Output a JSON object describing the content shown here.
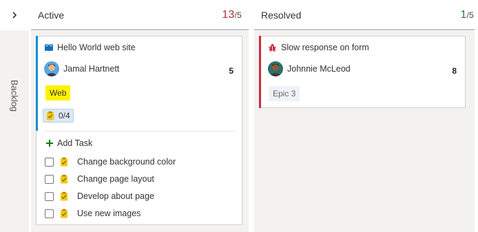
{
  "backlog": {
    "label": "Backlog",
    "toggle_icon": "chevron-right-icon"
  },
  "columns": [
    {
      "title": "Active",
      "count": "13",
      "limit": "/5",
      "count_color": "#b03030",
      "cards": [
        {
          "type_icon": "book-icon",
          "title": "Hello World web site",
          "assignee": "Jamal Hartnett",
          "effort": "5",
          "tag": "Web",
          "tag_color": "#fff200",
          "bar_color": "#0e8fd0",
          "progress": "0/4",
          "add_task_label": "Add Task",
          "tasks": [
            {
              "label": "Change background color"
            },
            {
              "label": "Change page layout"
            },
            {
              "label": "Develop about page"
            },
            {
              "label": "Use new images"
            }
          ]
        }
      ]
    },
    {
      "title": "Resolved",
      "count": "1",
      "limit": "/5",
      "count_color": "#2e7d32",
      "cards": [
        {
          "type_icon": "bug-icon",
          "title": "Slow response on form",
          "assignee": "Johnnie McLeod",
          "effort": "8",
          "tag": "Epic 3",
          "bar_color": "#cc293d"
        }
      ]
    }
  ]
}
